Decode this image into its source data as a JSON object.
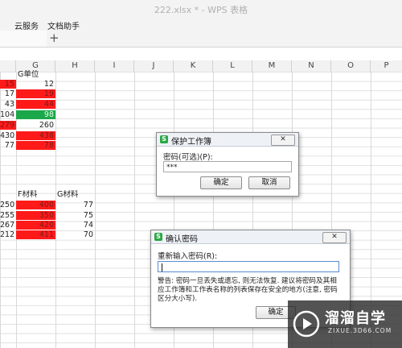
{
  "window": {
    "title": "222.xlsx * - WPS 表格"
  },
  "menu": {
    "items": [
      "云服务",
      "文档助手"
    ]
  },
  "tabs": {
    "new_tab": "+"
  },
  "columns": [
    "G",
    "H",
    "I",
    "J",
    "K",
    "L",
    "M",
    "N",
    "O",
    "P"
  ],
  "sheet": {
    "g_header": "G单位",
    "col_f": [
      "15",
      "17",
      "43",
      "104",
      "279",
      "430",
      "77"
    ],
    "col_g": [
      "12",
      "19",
      "44",
      "98",
      "260",
      "438",
      "78"
    ],
    "header_f2": "F材料",
    "header_g2": "G材料",
    "col_e2": [
      "250",
      "255",
      "267",
      "212"
    ],
    "col_f2": [
      "400",
      "350",
      "420",
      "411"
    ],
    "col_g2": [
      "77",
      "75",
      "74",
      "70"
    ]
  },
  "colors": {
    "red": "#ff1a1a",
    "green": "#1aa84a"
  },
  "dialog_protect": {
    "title": "保护工作簿",
    "password_label": "密码(可选)(P):",
    "password_value": "***",
    "ok": "确定",
    "cancel": "取消",
    "close_icon": "close-icon"
  },
  "dialog_confirm": {
    "title": "确认密码",
    "reenter_label": "重新输入密码(R):",
    "warning": "警告: 密码一旦丢失或遗忘, 则无法恢复. 建议将密码及其相应工作簿和工作表名称的列表保存在安全的地方(注意, 密码区分大小写).",
    "ok": "确定",
    "close_icon": "close-icon"
  },
  "watermark": {
    "brand": "溜溜自学",
    "url": "ZIXUE.3D66.COM"
  }
}
